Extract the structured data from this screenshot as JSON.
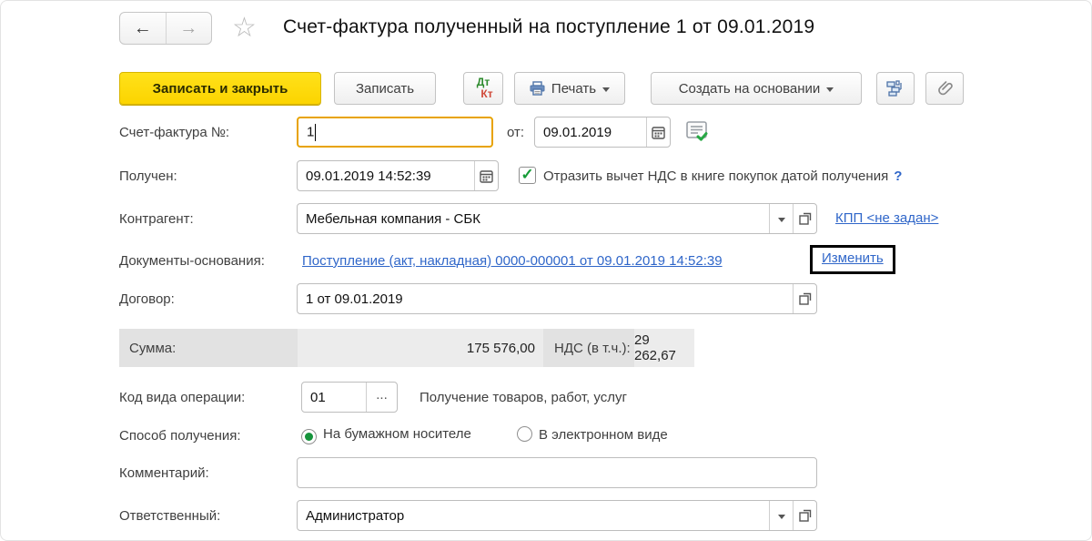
{
  "header": {
    "title": "Счет-фактура полученный на поступление 1 от 09.01.2019",
    "back_glyph": "←",
    "forward_glyph": "→",
    "star_glyph": "☆"
  },
  "toolbar": {
    "save_close_label": "Записать и закрыть",
    "save_label": "Записать",
    "dtkt_top": "Дт",
    "dtkt_bottom": "Кт",
    "print_label": "Печать",
    "create_based_on_label": "Создать на основании"
  },
  "fields": {
    "invoice_number": {
      "label": "Счет-фактура №:",
      "value": "1"
    },
    "invoice_date": {
      "label": "от:",
      "value": "09.01.2019"
    },
    "received": {
      "label": "Получен:",
      "value": "09.01.2019 14:52:39"
    },
    "vat_checkbox": {
      "checked_glyph": "✓",
      "label": "Отразить вычет НДС в книге покупок датой получения",
      "help": "?"
    },
    "counterparty": {
      "label": "Контрагент:",
      "value": "Мебельная компания - СБК"
    },
    "kpp_link": "КПП <не задан>",
    "base_documents": {
      "label": "Документы-основания:",
      "link": "Поступление (акт, накладная) 0000-000001 от 09.01.2019 14:52:39",
      "change_link": "Изменить"
    },
    "contract": {
      "label": "Договор:",
      "value": "1 от 09.01.2019"
    },
    "totals": {
      "sum_label": "Сумма:",
      "sum_value": "175 576,00",
      "vat_label": "НДС (в т.ч.):",
      "vat_value": "29 262,67"
    },
    "operation_code": {
      "label": "Код вида операции:",
      "value": "01",
      "more_glyph": "...",
      "description": "Получение товаров, работ, услуг"
    },
    "receipt_method": {
      "label": "Способ получения:",
      "options": [
        {
          "label": "На бумажном носителе",
          "selected": true
        },
        {
          "label": "В электронном виде",
          "selected": false
        }
      ]
    },
    "comment": {
      "label": "Комментарий:",
      "value": ""
    },
    "responsible": {
      "label": "Ответственный:",
      "value": "Администратор"
    }
  },
  "colors": {
    "accent_yellow": "#fcd400",
    "link_blue": "#2f66c9",
    "check_green": "#169c38",
    "band_gray": "#e2e2e2"
  }
}
